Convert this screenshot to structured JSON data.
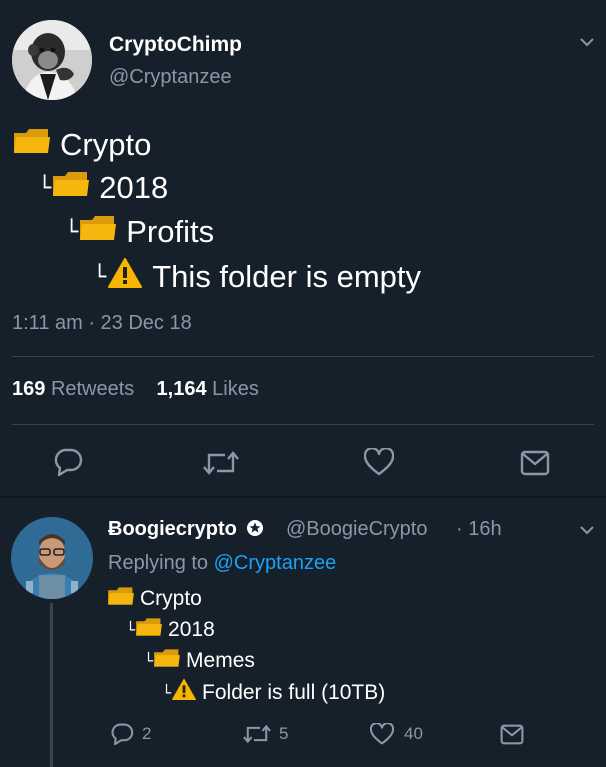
{
  "tweet": {
    "author_name": "CryptoChimp",
    "author_handle": "@Cryptanzee",
    "tree": [
      {
        "branch": "",
        "icon": "folder-icon",
        "label": "Crypto"
      },
      {
        "branch": "└",
        "icon": "folder-icon",
        "label": "2018"
      },
      {
        "branch": "└",
        "icon": "folder-icon",
        "label": "Profits"
      },
      {
        "branch": "└",
        "icon": "warning-icon",
        "label": "This folder is empty"
      }
    ],
    "timestamp": "1:11 am · 23 Dec 18",
    "retweets_count": "169",
    "retweets_label": "Retweets",
    "likes_count": "1,164",
    "likes_label": "Likes",
    "actions": [
      "reply-icon",
      "retweet-icon",
      "like-icon",
      "dm-icon"
    ]
  },
  "reply": {
    "author_name": "Ƀoogiecrypto",
    "verified_icon": "star-badge-icon",
    "author_handle": "@BoogieCrypto",
    "time": "· 16h",
    "replying_prefix": "Replying to",
    "replying_to": "@Cryptanzee",
    "tree": [
      {
        "branch": "",
        "icon": "folder-icon",
        "label": "Crypto"
      },
      {
        "branch": "└",
        "icon": "folder-icon",
        "label": "2018"
      },
      {
        "branch": "└",
        "icon": "folder-icon",
        "label": "Memes"
      },
      {
        "branch": "└",
        "icon": "warning-icon",
        "label": "Folder is full (10TB)"
      }
    ],
    "reply_count": "2",
    "retweet_count": "5",
    "like_count": "40"
  },
  "colors": {
    "background": "#15202b",
    "muted": "#8899a6",
    "link": "#1da1f2",
    "divider": "#38444d",
    "folder": "#f5b70d",
    "warning": "#f7b500"
  }
}
